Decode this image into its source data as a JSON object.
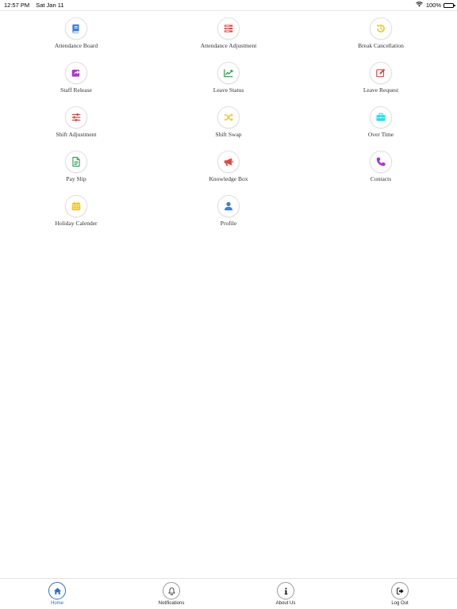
{
  "status_bar": {
    "time": "12:57 PM",
    "date": "Sat Jan 11",
    "battery": "100%"
  },
  "colors": {
    "accent": "#2a6fcf",
    "icon_blue": "#3d7ee0",
    "icon_red": "#e8453c",
    "icon_yellow": "#f0c419",
    "icon_purple": "#b02ee0",
    "icon_green": "#22a04b",
    "icon_cyan": "#1ee3ee"
  },
  "menu": [
    {
      "label": "Attendance Board",
      "icon": "book-icon"
    },
    {
      "label": "Attendance Adjustment",
      "icon": "stacked-list-icon"
    },
    {
      "label": "Break Cancellation",
      "icon": "undo-clock-icon"
    },
    {
      "label": "Staff Release",
      "icon": "share-icon"
    },
    {
      "label": "Leave Status",
      "icon": "line-chart-icon"
    },
    {
      "label": "Leave Request",
      "icon": "edit-icon"
    },
    {
      "label": "Shift Adjustment",
      "icon": "sliders-icon"
    },
    {
      "label": "Shift Swap",
      "icon": "shuffle-icon"
    },
    {
      "label": "Over Time",
      "icon": "briefcase-icon"
    },
    {
      "label": "Pay Slip",
      "icon": "document-icon"
    },
    {
      "label": "Knowledge Box",
      "icon": "megaphone-icon"
    },
    {
      "label": "Contacts",
      "icon": "phone-icon"
    },
    {
      "label": "Holiday Calender",
      "icon": "calendar-icon"
    },
    {
      "label": "Profile",
      "icon": "user-icon"
    }
  ],
  "tabbar": {
    "tabs": [
      {
        "label": "Home",
        "icon": "home-icon",
        "active": true
      },
      {
        "label": "Notifications",
        "icon": "bell-icon",
        "active": false
      },
      {
        "label": "About Us",
        "icon": "info-icon",
        "active": false
      },
      {
        "label": "Log Out",
        "icon": "logout-icon",
        "active": false
      }
    ]
  }
}
